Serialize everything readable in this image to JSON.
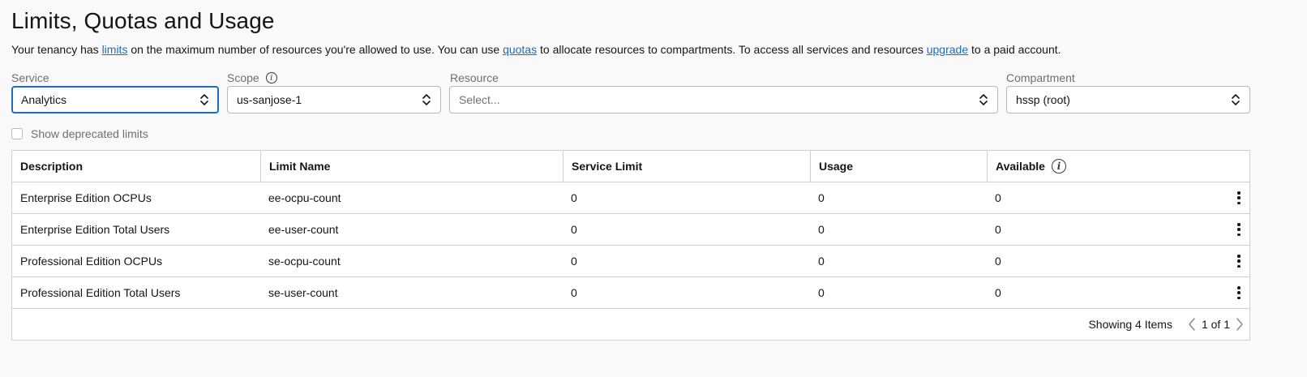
{
  "page": {
    "title": "Limits, Quotas and Usage",
    "intro": {
      "p1": "Your tenancy has ",
      "link_limits": "limits",
      "p2": " on the maximum number of resources you're allowed to use. You can use ",
      "link_quotas": "quotas",
      "p3": " to allocate resources to compartments. To access all services and resources ",
      "link_upgrade": "upgrade",
      "p4": " to a paid account."
    }
  },
  "filters": {
    "service": {
      "label": "Service",
      "value": "Analytics"
    },
    "scope": {
      "label": "Scope",
      "value": "us-sanjose-1"
    },
    "resource": {
      "label": "Resource",
      "placeholder": "Select..."
    },
    "compartment": {
      "label": "Compartment",
      "value": "hssp (root)"
    }
  },
  "deprecated_checkbox": {
    "label": "Show deprecated limits",
    "checked": false
  },
  "table": {
    "columns": [
      "Description",
      "Limit Name",
      "Service Limit",
      "Usage",
      "Available"
    ],
    "rows": [
      {
        "description": "Enterprise Edition OCPUs",
        "limit_name": "ee-ocpu-count",
        "service_limit": "0",
        "usage": "0",
        "available": "0"
      },
      {
        "description": "Enterprise Edition Total Users",
        "limit_name": "ee-user-count",
        "service_limit": "0",
        "usage": "0",
        "available": "0"
      },
      {
        "description": "Professional Edition OCPUs",
        "limit_name": "se-ocpu-count",
        "service_limit": "0",
        "usage": "0",
        "available": "0"
      },
      {
        "description": "Professional Edition Total Users",
        "limit_name": "se-user-count",
        "service_limit": "0",
        "usage": "0",
        "available": "0"
      }
    ],
    "footer": {
      "showing": "Showing 4 Items",
      "page": "1 of 1"
    }
  },
  "colors": {
    "accent": "#1a6dbf",
    "border": "#cfcfcf",
    "background": "#f9f9f9"
  }
}
